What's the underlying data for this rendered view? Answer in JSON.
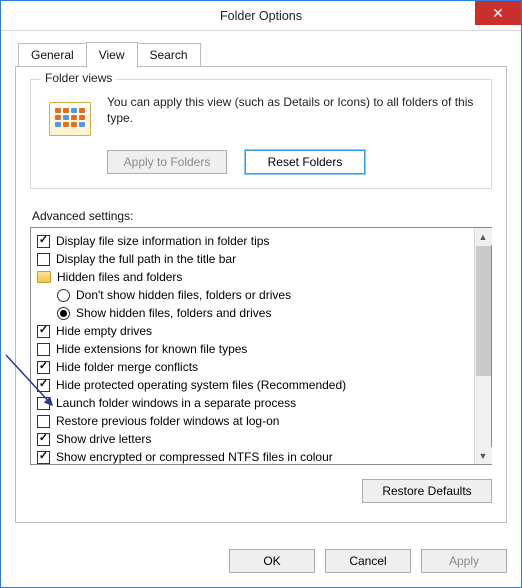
{
  "window": {
    "title": "Folder Options"
  },
  "tabs": {
    "general": "General",
    "view": "View",
    "search": "Search",
    "active": "View"
  },
  "folderViews": {
    "legend": "Folder views",
    "desc": "You can apply this view (such as Details or Icons) to all folders of this type.",
    "applyBtn": "Apply to Folders",
    "resetBtn": "Reset Folders"
  },
  "advanced": {
    "label": "Advanced settings:",
    "items": [
      {
        "kind": "checkbox",
        "checked": true,
        "text": "Display file size information in folder tips"
      },
      {
        "kind": "checkbox",
        "checked": false,
        "text": "Display the full path in the title bar"
      },
      {
        "kind": "header",
        "text": "Hidden files and folders"
      },
      {
        "kind": "radio",
        "checked": false,
        "text": "Don't show hidden files, folders or drives"
      },
      {
        "kind": "radio",
        "checked": true,
        "text": "Show hidden files, folders and drives"
      },
      {
        "kind": "checkbox",
        "checked": true,
        "text": "Hide empty drives"
      },
      {
        "kind": "checkbox",
        "checked": false,
        "text": "Hide extensions for known file types"
      },
      {
        "kind": "checkbox",
        "checked": true,
        "text": "Hide folder merge conflicts"
      },
      {
        "kind": "checkbox",
        "checked": true,
        "text": "Hide protected operating system files (Recommended)"
      },
      {
        "kind": "checkbox",
        "checked": false,
        "text": "Launch folder windows in a separate process"
      },
      {
        "kind": "checkbox",
        "checked": false,
        "text": "Restore previous folder windows at log-on"
      },
      {
        "kind": "checkbox",
        "checked": true,
        "text": "Show drive letters"
      },
      {
        "kind": "checkbox",
        "checked": true,
        "text": "Show encrypted or compressed NTFS files in colour"
      }
    ],
    "restoreBtn": "Restore Defaults"
  },
  "buttons": {
    "ok": "OK",
    "cancel": "Cancel",
    "apply": "Apply"
  }
}
